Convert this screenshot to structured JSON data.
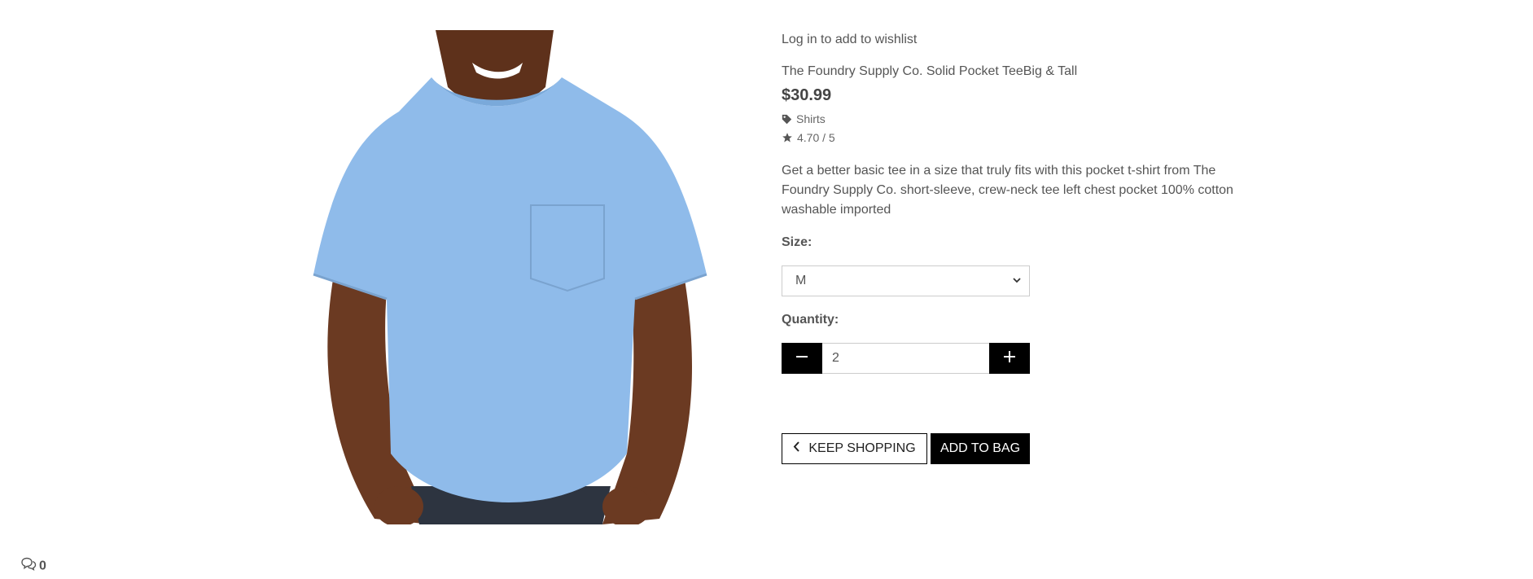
{
  "product": {
    "wishlist_link": "Log in to add to wishlist",
    "name": "The Foundry Supply Co. Solid Pocket TeeBig & Tall",
    "price": "$30.99",
    "category": "Shirts",
    "rating": "4.70 / 5",
    "description": "Get a better basic tee in a size that truly fits with this pocket t-shirt from The Foundry Supply Co. short-sleeve, crew-neck tee left chest pocket 100% cotton washable imported"
  },
  "size": {
    "label": "Size:",
    "selected": "M"
  },
  "quantity": {
    "label": "Quantity:",
    "value": "2"
  },
  "actions": {
    "keep_shopping": "KEEP SHOPPING",
    "add_to_bag": "ADD TO BAG"
  },
  "comments": {
    "count": "0"
  },
  "icons": {
    "category": "tag-icon",
    "rating": "star-icon",
    "select": "chevron-down-icon",
    "decrement": "minus-icon",
    "increment": "plus-icon",
    "keep_shopping": "chevron-left-icon",
    "comments": "speech-bubbles-icon"
  },
  "colors": {
    "shirt": "#8fbbea",
    "skin": "#6b3a22",
    "button": "#000000"
  }
}
